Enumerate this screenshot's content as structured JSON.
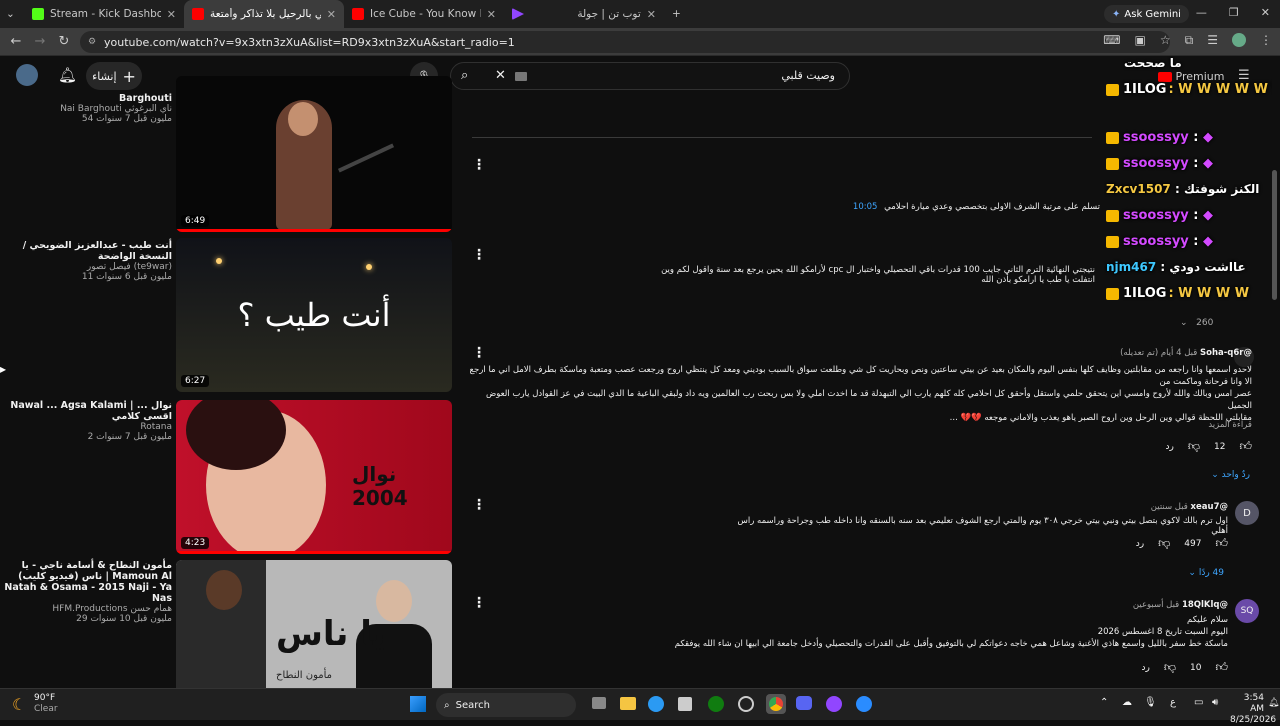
{
  "tabs": [
    {
      "label": "Stream - Kick Dashboard",
      "color": "#53fc18"
    },
    {
      "label": "اسمحيلي بالرحيل بلا تذاكر وأمتعة",
      "color": "#ff0000"
    },
    {
      "label": "Ice Cube - You Know How We Do It",
      "color": "#ff0000"
    },
    {
      "label": "",
      "color": "#9146ff"
    },
    {
      "label": "توب تن | جولة",
      "color": ""
    }
  ],
  "gemini": "Ask Gemini",
  "url": "youtube.com/watch?v=9x3xtn3zXuA&list=RD9x3xtn3zXuA&start_radio=1",
  "yt": {
    "create": "إنشاء",
    "search_value": "وصيت قلبي"
  },
  "videos": [
    {
      "title": "Barghouti",
      "channel": "Nai Barghouti ناي البرغوثي",
      "meta": "54 مليون  قبل 7 سنوات",
      "duration": "6:49"
    },
    {
      "title": "أنت طيب - عبدالعزيز الضويحي / النسخة الواضحة",
      "channel": "فيصل تصور (te9war)",
      "meta": "11 مليون  قبل 6 سنوات",
      "duration": "6:27",
      "overlay": "أنت طيب ؟"
    },
    {
      "title": "Nawal ... Agsa Kalami | نوال ... اقسى كلامي",
      "channel": "Rotana",
      "meta": "2 مليون  قبل 7 سنوات",
      "duration": "4:23",
      "overlay": "نوال 2004"
    },
    {
      "title": "مأمون النطاح & أسامة ناجي - يا ناس (فيديو كليب) | Mamoun Al Natah & Osama - 2015 Naji - Ya Nas",
      "channel": "HFM.Productions همام حسن",
      "meta": "29 مليون  قبل 10 سنوات",
      "overlay": "يا ناس",
      "overlay2": "مأمون النطاح"
    }
  ],
  "comments": [
    {
      "text": "تسلم على مرتبة الشرف الاولى بتخصصي وعدي ميارة احلامي",
      "time": "10:05"
    },
    {
      "text": "نتيجتي النهائية الترم الثاني جايب 100 قدرات باقي التحصيلي واختبار ال cpc لأرامكو الله يحين يرجع بعد سنة واقول لكم وين انتفلت يا طب يا ارامكو بأذن الله"
    },
    {
      "author": "@Soha-q6r",
      "time": "قبل 4 أيام (تم تعديله)",
      "line1": "لاحدو اسمعها وانا راجعه من مقابلتين وظايف كلها بنفس اليوم والمكان بعيد عن بيتي ساعتين ونص وبحاريت كل شي وطلعت سواق بالسبب بوديني ومعد كل ينتظي اروح ورجعت عصب ومتعبة وماسكة بطرف الامل اني ما ارجع الا وانا فرحانة وماكمت من",
      "line2": "عصر امس وبالك والله لأروح وامسي اين يتحقق حلمي واستقل وأحقق كل احلامي كله كلهم يارب الي التبهدلة قد ما اخدت املي ولا بس ربحت رب العالمين ويه داد ولبقي الباعية ما الدي البيت في عز القوادل يارب العوض",
      "line3": "الجميل",
      "line4": "مقابلتي اللحظة قوالي وين الرحل وين اروح الصبر ياهو يعذب والاماني موجعه 💔💔 ...",
      "more": "قراءة المزيد",
      "likes": "12",
      "reply": "رد",
      "replies": "ردٌ واحد"
    },
    {
      "author": "@xeau7",
      "time": "قبل سنتين",
      "text": "اول ترم بالك لاكوي بتصل بيتي ونبي بيتي خرجي ٣٠٨ يوم والمتي ارجع الشوف تعليمي بعد سنه بالسنقه وانا داخله طب وجراحة وراسمه راس أهلي",
      "likes": "497",
      "reply": "رد",
      "replies": "49 ردًا",
      "avatar": "D"
    },
    {
      "author": "@18QlKlq",
      "time": "قبل أسبوعين",
      "l1": "سلام عليكم",
      "l2": "اليوم السبت تاريخ 8 اغسطس 2026",
      "l3": "ماسكة خط سفر بالليل واسمع هاذي الأغنية وشاعل همي خاجه دعواتكم لي بالتوفيق وأقبل على القدرات والتحصيلي وأدخل جامعة الي ابيها ان شاء الله يوفقكم",
      "likes": "10",
      "reply": "رد",
      "avatar": "SQ"
    }
  ],
  "chat": [
    {
      "user": "ما صححت",
      "text": ""
    },
    {
      "user": "1ILOG",
      "text": ": W W W W W W"
    },
    {
      "user": "ssoossyy",
      "text": ":"
    },
    {
      "user": "ssoossyy",
      "text": ":"
    },
    {
      "user": "Zxcv1507",
      "text": ": الكنز شوفتك"
    },
    {
      "user": "ssoossyy",
      "text": ":"
    },
    {
      "user": "ssoossyy",
      "text": ":"
    },
    {
      "user": "njm467",
      "text": ": عااشت دودي"
    },
    {
      "user": "1ILOG",
      "text": ": W W W W"
    }
  ],
  "yt_right": {
    "premium": "Premium",
    "count": "260"
  },
  "taskbar": {
    "temp": "90°F",
    "weather": "Clear",
    "search": "Search",
    "time": "3:54 AM",
    "date": "8/25/2026",
    "lang": "ع"
  }
}
